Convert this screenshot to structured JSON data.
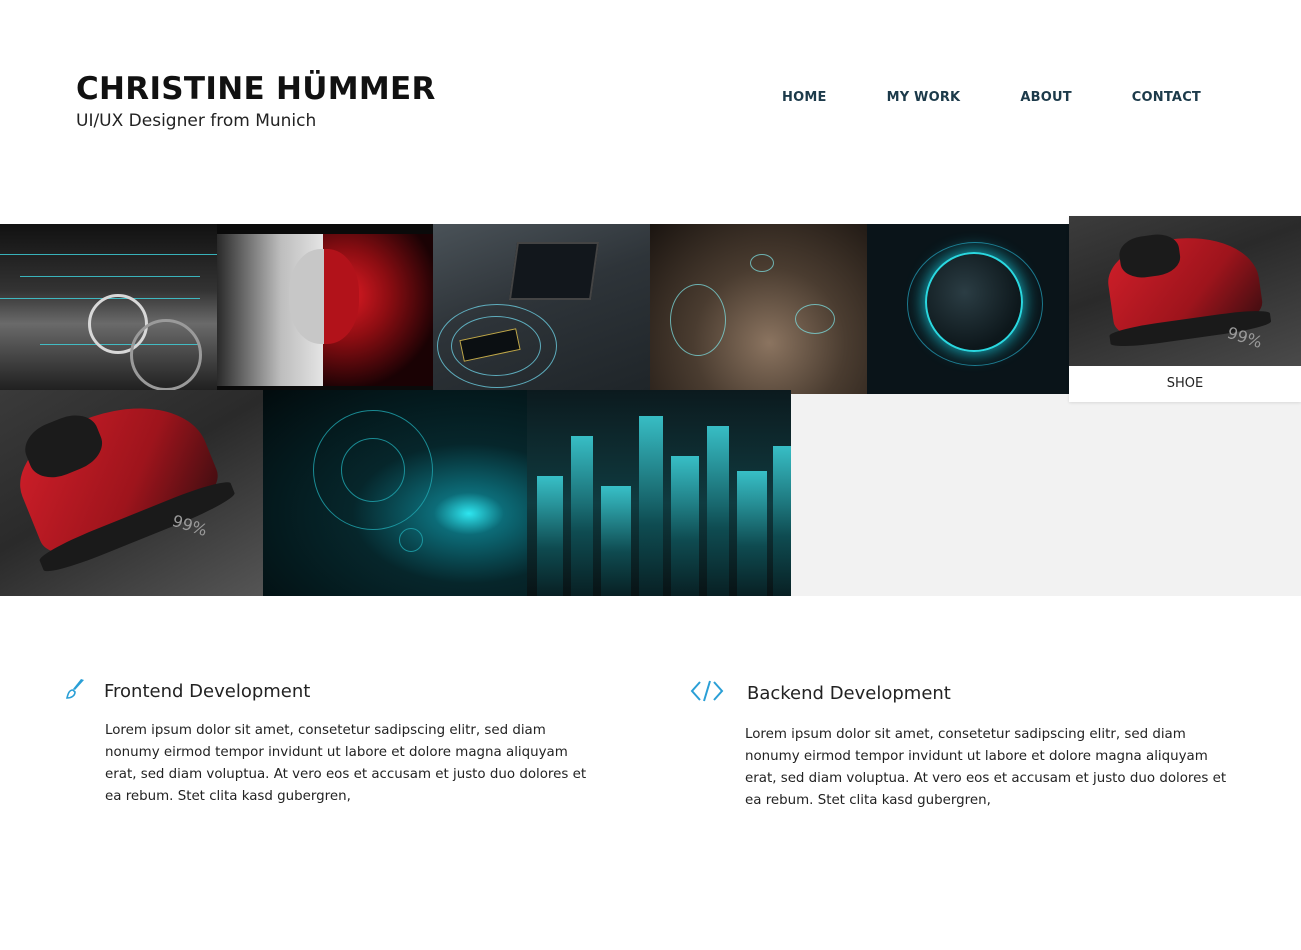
{
  "header": {
    "name": "CHRISTINE HÜMMER",
    "tagline": "UI/UX Designer from Munich"
  },
  "nav": {
    "items": [
      {
        "label": "HOME"
      },
      {
        "label": "MY WORK"
      },
      {
        "label": "ABOUT"
      },
      {
        "label": "CONTACT"
      }
    ]
  },
  "gallery": {
    "hover_caption": "SHOE",
    "shoe_badge_1": "99%",
    "shoe_badge_2": "99%"
  },
  "services": [
    {
      "icon": "brush-icon",
      "title": "Frontend Development",
      "text": "Lorem ipsum dolor sit amet, consetetur sadipscing elitr, sed diam nonumy eirmod tempor invidunt ut labore et dolore magna aliquyam erat, sed diam voluptua. At vero eos et accusam et justo duo dolores et ea rebum. Stet clita kasd gubergren,"
    },
    {
      "icon": "code-icon",
      "title": "Backend Development",
      "text": "Lorem ipsum dolor sit amet, consetetur sadipscing elitr, sed diam nonumy eirmod tempor invidunt ut labore et dolore magna aliquyam erat, sed diam voluptua. At vero eos et accusam et justo duo dolores et ea rebum. Stet clita kasd gubergren,"
    }
  ],
  "colors": {
    "nav": "#1c3a4a",
    "accent": "#2a9fd6",
    "gallery_bg": "#f2f2f2"
  }
}
